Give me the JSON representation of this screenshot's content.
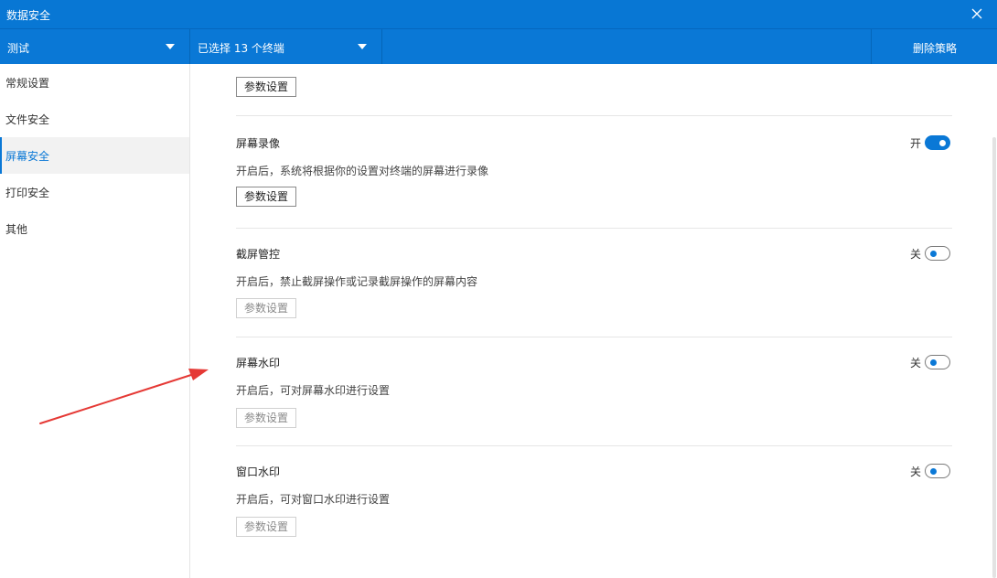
{
  "window": {
    "title": "数据安全"
  },
  "toolbar": {
    "policy_select": "测试",
    "terminal_select": "已选择 13 个终端",
    "delete_label": "删除策略"
  },
  "sidebar": {
    "items": [
      {
        "label": "常规设置"
      },
      {
        "label": "文件安全"
      },
      {
        "label": "屏幕安全",
        "active": true
      },
      {
        "label": "打印安全"
      },
      {
        "label": "其他"
      }
    ]
  },
  "main": {
    "top_button": "参数设置",
    "sections": [
      {
        "title": "屏幕录像",
        "description": "开启后，系统将根据你的设置对终端的屏幕进行录像",
        "toggle_label": "开",
        "enabled": true,
        "button": "参数设置"
      },
      {
        "title": "截屏管控",
        "description": "开启后，禁止截屏操作或记录截屏操作的屏幕内容",
        "toggle_label": "关",
        "enabled": false,
        "button": "参数设置"
      },
      {
        "title": "屏幕水印",
        "description": "开启后，可对屏幕水印进行设置",
        "toggle_label": "关",
        "enabled": false,
        "button": "参数设置"
      },
      {
        "title": "窗口水印",
        "description": "开启后，可对窗口水印进行设置",
        "toggle_label": "关",
        "enabled": false,
        "button": "参数设置"
      }
    ]
  },
  "colors": {
    "accent": "#0a78d6",
    "annotation": "#e53935"
  }
}
